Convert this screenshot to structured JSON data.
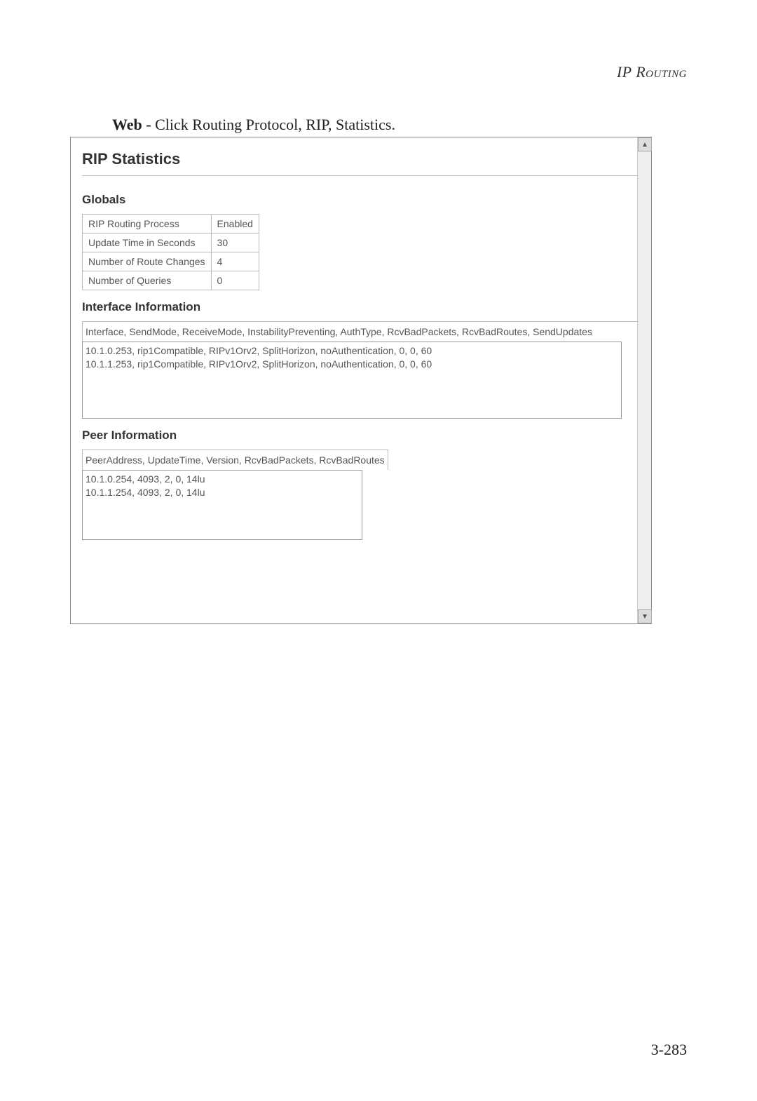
{
  "header": {
    "title": "IP Routing"
  },
  "instruction": {
    "bold": "Web - ",
    "rest": "Click Routing Protocol, RIP, Statistics."
  },
  "panel": {
    "title": "RIP Statistics",
    "globals": {
      "heading": "Globals",
      "rows": [
        {
          "label": "RIP Routing Process",
          "value": "Enabled"
        },
        {
          "label": "Update Time in Seconds",
          "value": "30"
        },
        {
          "label": "Number of Route Changes",
          "value": "4"
        },
        {
          "label": "Number of Queries",
          "value": "0"
        }
      ]
    },
    "interface": {
      "heading": "Interface Information",
      "columns": "Interface, SendMode, ReceiveMode, InstabilityPreventing, AuthType, RcvBadPackets, RcvBadRoutes, SendUpdates",
      "rows": [
        "10.1.0.253, rip1Compatible, RIPv1Orv2, SplitHorizon, noAuthentication, 0, 0, 60",
        "10.1.1.253, rip1Compatible, RIPv1Orv2, SplitHorizon, noAuthentication, 0, 0, 60"
      ]
    },
    "peer": {
      "heading": "Peer Information",
      "columns": "PeerAddress, UpdateTime, Version, RcvBadPackets, RcvBadRoutes",
      "rows": [
        "10.1.0.254, 4093, 2, 0, 14lu",
        "10.1.1.254, 4093, 2, 0, 14lu"
      ]
    }
  },
  "pageNumber": "3-283",
  "icons": {
    "up": "▲",
    "down": "▼"
  }
}
